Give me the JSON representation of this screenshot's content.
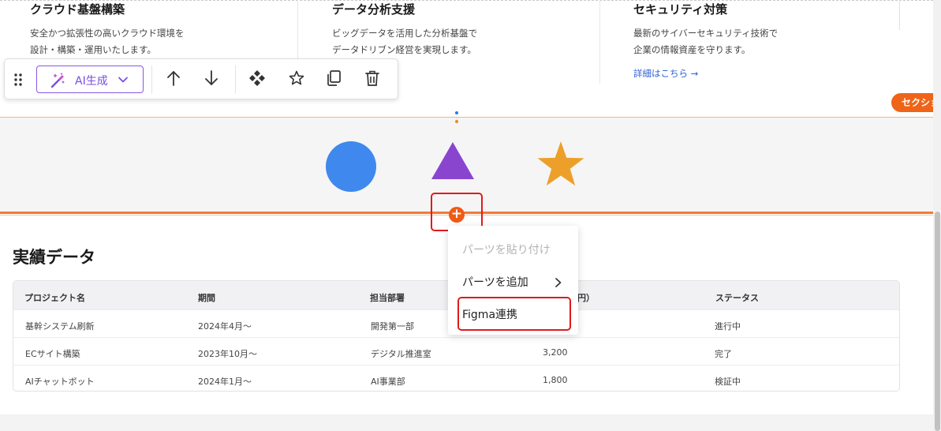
{
  "services": {
    "cards": [
      {
        "title": "クラウド基盤構築",
        "desc1": "安全かつ拡張性の高いクラウド環境を",
        "desc2": "設計・構築・運用いたします。",
        "link": ""
      },
      {
        "title": "データ分析支援",
        "desc1": "ビッグデータを活用した分析基盤で",
        "desc2": "データドリブン経営を実現します。",
        "link": ""
      },
      {
        "title": "セキュリティ対策",
        "desc1": "最新のサイバーセキュリティ技術で",
        "desc2": "企業の情報資産を守ります。",
        "link": "詳細はこちら →"
      }
    ]
  },
  "toolbar": {
    "ai_label": "AI生成",
    "items": [
      "drag-handle-icon",
      "magic-wand-icon",
      "chevron-down-icon",
      "arrow-up-icon",
      "arrow-down-icon",
      "component-icon",
      "star-icon",
      "copy-icon",
      "trash-icon"
    ]
  },
  "section_badge": "セクション",
  "shapes": {
    "circle_color": "#3f88ee",
    "triangle_color": "#8a45cf",
    "star_color": "#eca029"
  },
  "results": {
    "title": "実績データ",
    "columns": [
      "プロジェクト名",
      "期間",
      "担当部署",
      "予算（万円）",
      "ステータス"
    ],
    "rows": [
      [
        "基幹システム刷新",
        "2024年4月〜",
        "開発第一部",
        "",
        "進行中"
      ],
      [
        "ECサイト構築",
        "2023年10月〜",
        "デジタル推進室",
        "3,200",
        "完了"
      ],
      [
        "AIチャットボット",
        "2024年1月〜",
        "AI事業部",
        "1,800",
        "検証中"
      ]
    ]
  },
  "context_menu": {
    "items": [
      {
        "label": "パーツを貼り付け",
        "disabled": true
      },
      {
        "label": "パーツを追加",
        "submenu": true
      },
      {
        "label": "Figma連携"
      }
    ]
  },
  "colors": {
    "accent": "#ef6418",
    "ai_purple": "#7b4ce3",
    "highlight": "#e01b1b"
  }
}
